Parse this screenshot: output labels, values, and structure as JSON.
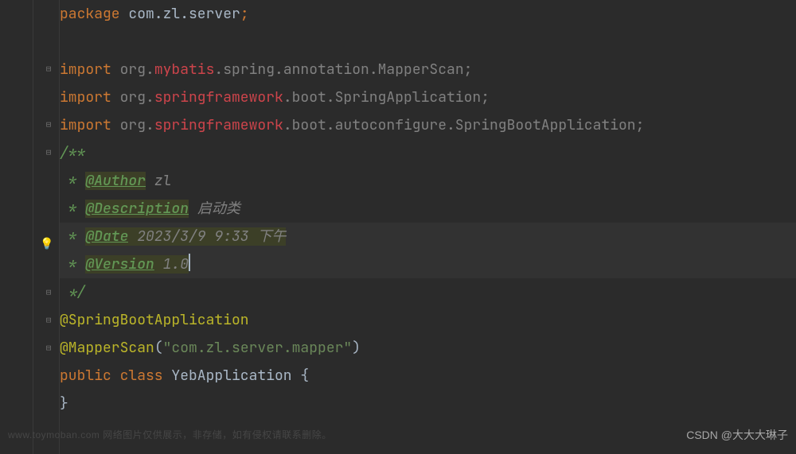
{
  "code": {
    "l1_kw": "package",
    "l1_pkg": " com.zl.server",
    "l1_semicolon": ";",
    "l3_kw": "import",
    "l3_org": " org.",
    "l3_mybatis": "mybatis",
    "l3_rest": ".spring.annotation.MapperScan;",
    "l4_kw": "import",
    "l4_org": " org.",
    "l4_sf": "springframework",
    "l4_rest": ".boot.SpringApplication;",
    "l5_kw": "import",
    "l5_org": " org.",
    "l5_sf": "springframework",
    "l5_rest": ".boot.autoconfigure.SpringBootApplication;",
    "l6_comment": "/**",
    "l7_star": " * ",
    "l7_tag": "@Author",
    "l7_val": " zl",
    "l8_star": " * ",
    "l8_tag": "@Description",
    "l8_val": " 启动类",
    "l9_star": " * ",
    "l9_tag": "@Date",
    "l9_val": " 2023/3/9 9:33 下午",
    "l10_star": " * ",
    "l10_tag": "@Version",
    "l10_val": " 1.0",
    "l11_comment": " */",
    "l12_anno": "@SpringBootApplication",
    "l13_anno": "@MapperScan",
    "l13_paren_open": "(",
    "l13_str": "\"com.zl.server.mapper\"",
    "l13_paren_close": ")",
    "l14_public": "public ",
    "l14_class": "class",
    "l14_name": " YebApplication ",
    "l14_brace": "{",
    "l15_brace": "}"
  },
  "watermarks": {
    "left": "www.toymoban.com 网络图片仅供展示，非存储，如有侵权请联系删除。",
    "right": "CSDN @大大大琳子"
  }
}
